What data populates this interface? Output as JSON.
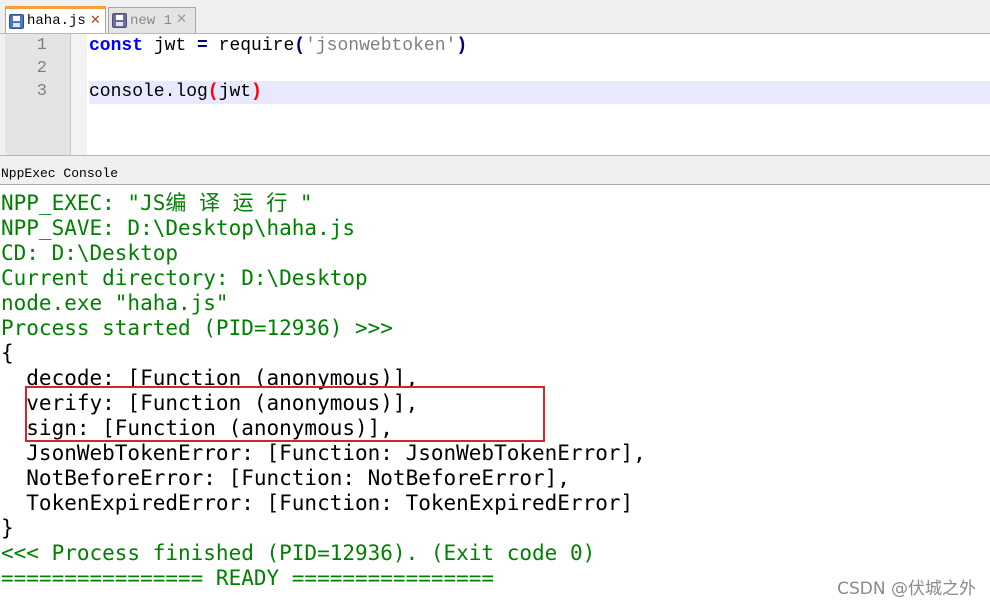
{
  "tabs": [
    {
      "label": "haha.js",
      "active": true
    },
    {
      "label": "new 1",
      "active": false
    }
  ],
  "editor": {
    "line_numbers": [
      "1",
      "2",
      "3"
    ],
    "line1": {
      "keyword": "const",
      "var": " jwt ",
      "op": "=",
      "func": " require",
      "open": "(",
      "string": "'jsonwebtoken'",
      "close": ")"
    },
    "line3": {
      "func": "console.log",
      "open": "(",
      "arg": "jwt",
      "close": ")"
    }
  },
  "console": {
    "title": "NppExec Console",
    "lines": [
      {
        "text": "NPP_EXEC: \"JS编 译 运 行 \"",
        "color": "green"
      },
      {
        "text": "NPP_SAVE: D:\\Desktop\\haha.js",
        "color": "green"
      },
      {
        "text": "CD: D:\\Desktop",
        "color": "green"
      },
      {
        "text": "Current directory: D:\\Desktop",
        "color": "green"
      },
      {
        "text": "node.exe \"haha.js\"",
        "color": "green"
      },
      {
        "text": "Process started (PID=12936) >>>",
        "color": "green"
      },
      {
        "text": "{",
        "color": "black"
      },
      {
        "text": "  decode: [Function (anonymous)],",
        "color": "black"
      },
      {
        "text": "  verify: [Function (anonymous)],",
        "color": "black"
      },
      {
        "text": "  sign: [Function (anonymous)],",
        "color": "black"
      },
      {
        "text": "  JsonWebTokenError: [Function: JsonWebTokenError],",
        "color": "black"
      },
      {
        "text": "  NotBeforeError: [Function: NotBeforeError],",
        "color": "black"
      },
      {
        "text": "  TokenExpiredError: [Function: TokenExpiredError]",
        "color": "black"
      },
      {
        "text": "}",
        "color": "black"
      },
      {
        "text": "<<< Process finished (PID=12936). (Exit code 0)",
        "color": "green"
      },
      {
        "text": "================ READY ================",
        "color": "green"
      }
    ]
  },
  "watermark": "CSDN @伏城之外",
  "colors": {
    "console_green": "#008000",
    "highlight_box": "#d6242b",
    "tab_accent": "#fa9f3e"
  }
}
